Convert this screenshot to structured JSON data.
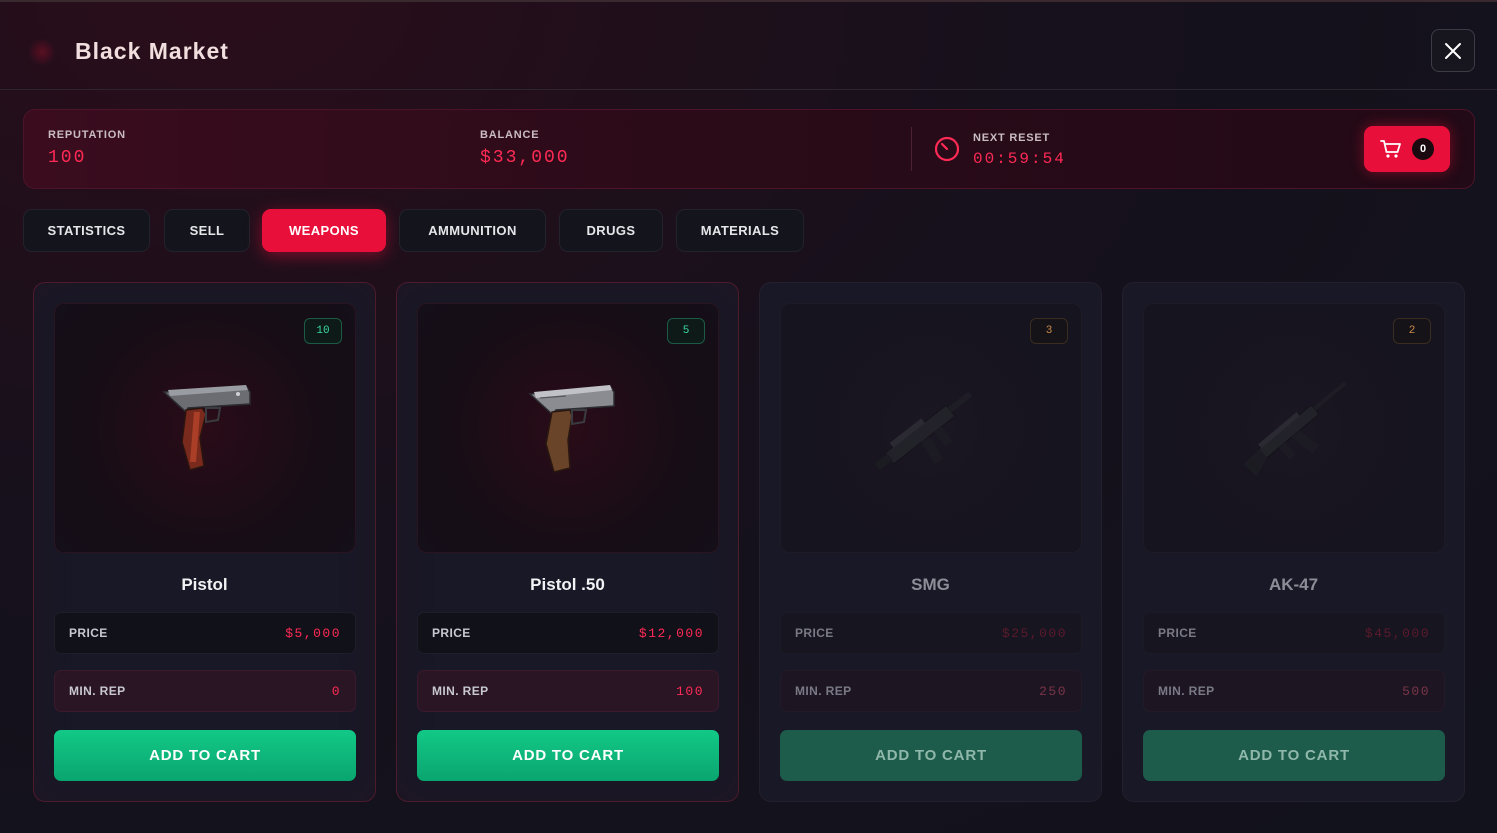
{
  "header": {
    "title": "Black Market"
  },
  "stats": {
    "reputation_label": "REPUTATION",
    "reputation_value": "100",
    "balance_label": "BALANCE",
    "balance_value": "$33,000",
    "reset_label": "NEXT RESET",
    "reset_value": "00:59:54",
    "cart_count": "0"
  },
  "tabs": [
    {
      "label": "STATISTICS",
      "active": false
    },
    {
      "label": "SELL",
      "active": false
    },
    {
      "label": "WEAPONS",
      "active": true
    },
    {
      "label": "AMMUNITION",
      "active": false
    },
    {
      "label": "DRUGS",
      "active": false
    },
    {
      "label": "MATERIALS",
      "active": false
    }
  ],
  "items": [
    {
      "name": "Pistol",
      "stock": "10",
      "price_label": "PRICE",
      "price": "$5,000",
      "rep_label": "MIN. REP",
      "min_rep": "0",
      "button": "ADD TO CART",
      "available": true,
      "icon": "pistol-icon"
    },
    {
      "name": "Pistol .50",
      "stock": "5",
      "price_label": "PRICE",
      "price": "$12,000",
      "rep_label": "MIN. REP",
      "min_rep": "100",
      "button": "ADD TO CART",
      "available": true,
      "icon": "pistol-50-icon"
    },
    {
      "name": "SMG",
      "stock": "3",
      "price_label": "PRICE",
      "price": "$25,000",
      "rep_label": "MIN. REP",
      "min_rep": "250",
      "button": "ADD TO CART",
      "available": false,
      "icon": "smg-icon"
    },
    {
      "name": "AK-47",
      "stock": "2",
      "price_label": "PRICE",
      "price": "$45,000",
      "rep_label": "MIN. REP",
      "min_rep": "500",
      "button": "ADD TO CART",
      "available": false,
      "icon": "rifle-icon"
    }
  ],
  "colors": {
    "accent": "#e8103a",
    "success": "#12c987",
    "value_red": "#ff2a55"
  }
}
